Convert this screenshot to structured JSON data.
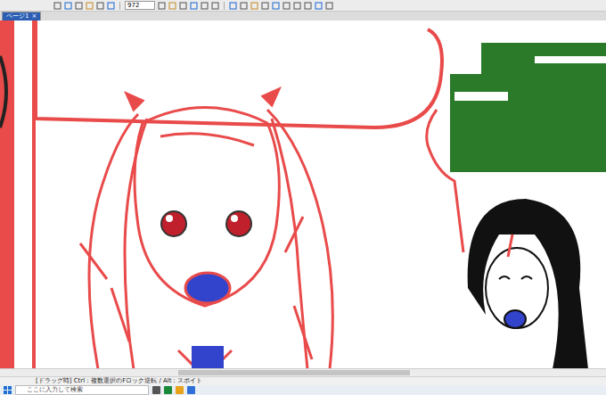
{
  "toolbar": {
    "zoom": "972"
  },
  "tabs": [
    {
      "label": "ページ1",
      "close": "×",
      "selected": true
    }
  ],
  "status_bar": {
    "text": "[ドラッグ時] Ctrl：複数選択のFロック逆転 / Alt：スポイト"
  },
  "taskbar": {
    "search_placeholder": "ここに入力して検索"
  }
}
